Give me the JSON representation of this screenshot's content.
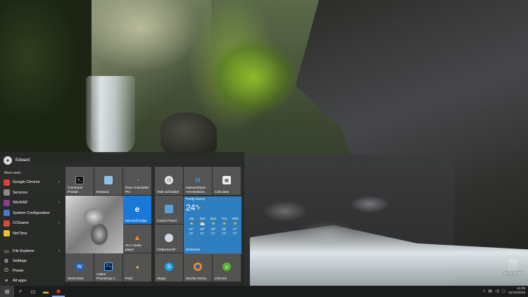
{
  "desktop": {
    "recycle_bin_label": "Recycle Bin"
  },
  "start_menu": {
    "user_name": "Edward",
    "most_used_label": "Most used",
    "most_used": [
      {
        "label": "Google Chrome",
        "color": "#e0403a",
        "has_submenu": true
      },
      {
        "label": "Services",
        "color": "#8c8c8c",
        "has_submenu": false
      },
      {
        "label": "WinRAR",
        "color": "#8a3c8c",
        "has_submenu": true
      },
      {
        "label": "System Configuration",
        "color": "#4a7bbf",
        "has_submenu": false
      },
      {
        "label": "CCleaner",
        "color": "#d94a3a",
        "has_submenu": true
      },
      {
        "label": "NetTime",
        "color": "#e8c22a",
        "has_submenu": false
      }
    ],
    "system_items": [
      {
        "label": "File Explorer",
        "icon": "folder-icon",
        "glyph": "▭",
        "has_submenu": true
      },
      {
        "label": "Settings",
        "icon": "gear-icon",
        "glyph": "⚙",
        "has_submenu": false
      },
      {
        "label": "Power",
        "icon": "power-icon",
        "glyph": "⏻",
        "has_submenu": false
      },
      {
        "label": "All apps",
        "icon": "all-apps-icon",
        "glyph": "≡",
        "has_submenu": false
      }
    ],
    "tiles": {
      "command_prompt": "Command Prompt",
      "notepad": "Notepad",
      "revo": "Revo Uninstaller Pro",
      "task_scheduler": "Task Scheduler",
      "malwarebytes": "Malwarebytes Anti-Malware...",
      "calculator": "Calculator",
      "edge": "Microsoft Edge",
      "control_panel": "Control Panel",
      "vlc": "VLC media player",
      "cdburner": "CDBurnerXP",
      "word": "Word 2016",
      "photoshop": "Adobe Photoshop C...",
      "paint": "Paint",
      "skype": "Skype",
      "firefox": "Mozilla Firefox",
      "utorrent": "uTorrent"
    },
    "weather": {
      "condition": "Partly Sunny",
      "temperature": "24°",
      "location": "Birkirkara",
      "days": [
        {
          "day": "Sat",
          "hi": "27°",
          "lo": "20°"
        },
        {
          "day": "Sun",
          "hi": "26°",
          "lo": "20°"
        },
        {
          "day": "Mon",
          "hi": "26°",
          "lo": "19°"
        },
        {
          "day": "Tue",
          "hi": "26°",
          "lo": "19°"
        },
        {
          "day": "Wed",
          "hi": "27°",
          "lo": "20°"
        }
      ]
    }
  },
  "taskbar": {
    "time": "11:25",
    "date": "10/10/2015"
  },
  "colors": {
    "edge_tile": "#1a78d6",
    "weather_tile": "#2f7ebf",
    "start_menu_bg": "#282a28"
  }
}
